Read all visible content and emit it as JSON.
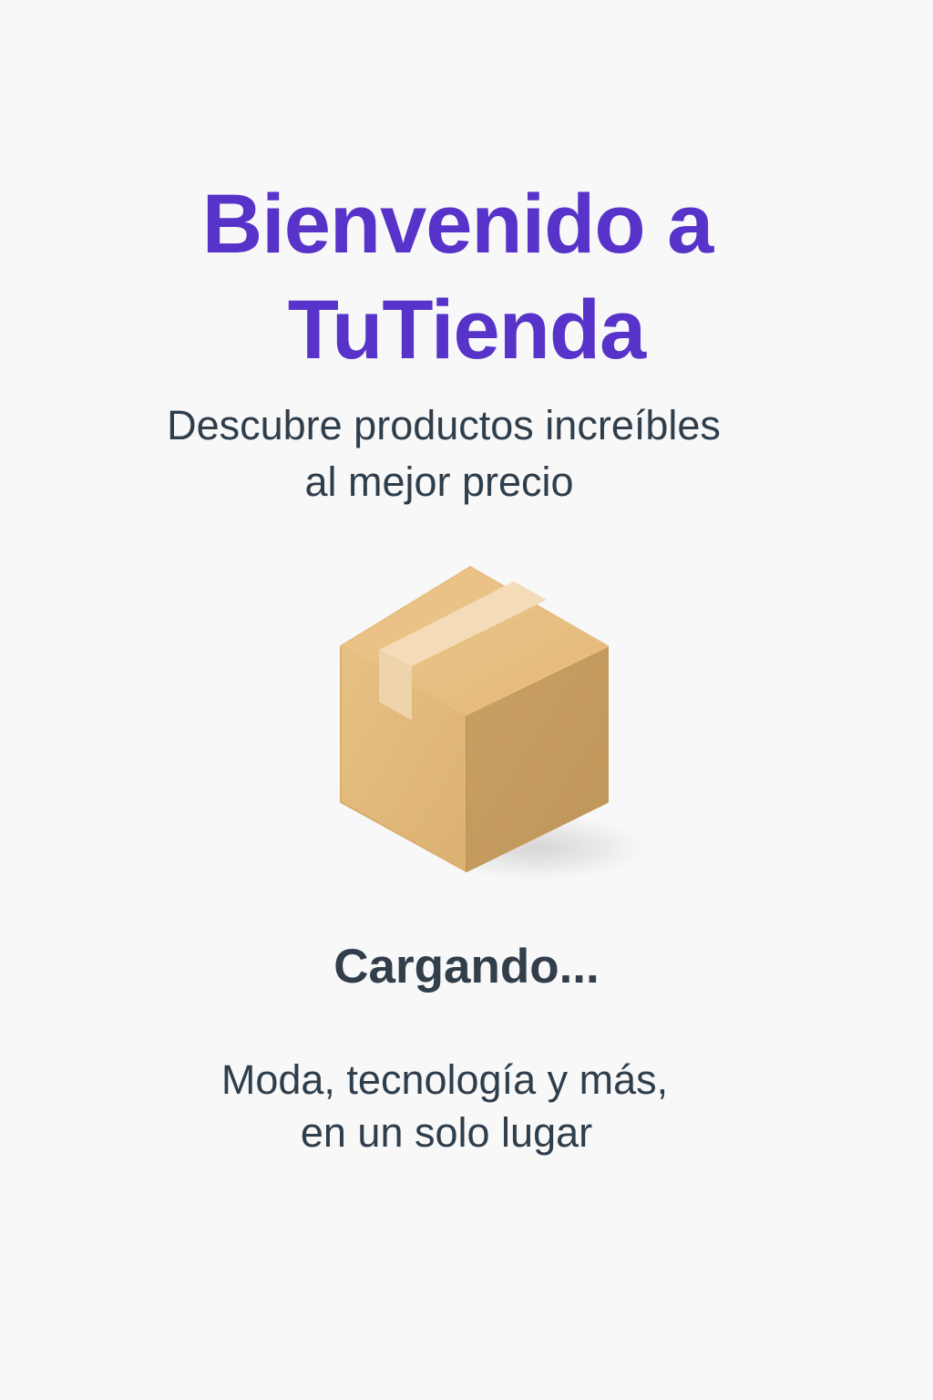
{
  "splash": {
    "title_line1": "Bienvenido a",
    "title_line2": "TuTienda",
    "tagline_line1": "Descubre productos increíbles",
    "tagline_line2": "al mejor precio",
    "illustration_icon": "package-box-icon",
    "loading_text": "Cargando...",
    "footer_line1": "Moda, tecnología y más,",
    "footer_line2": "en un solo lugar"
  },
  "colors": {
    "background": "#f8f8f9",
    "brand": "#5733c9",
    "text": "#2f3e4b",
    "box_light": "#e6bd7f",
    "box_dark": "#c79d62",
    "box_tape": "#f3dcb7"
  }
}
